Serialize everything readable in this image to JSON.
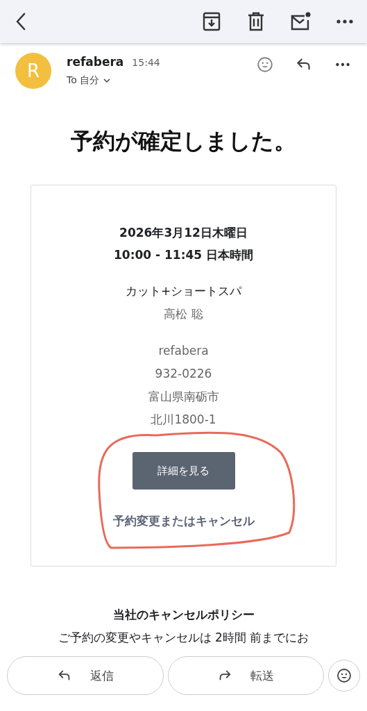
{
  "sender": {
    "avatar_letter": "R",
    "name": "refabera",
    "time": "15:44",
    "recipient": "To 自分"
  },
  "title": "予約が確定しました。",
  "card": {
    "date": "2026年3月12日木曜日",
    "time": "10:00 - 11:45 日本時間",
    "service": "カット+ショートスパ",
    "staff": "高松 聡",
    "address_lines": [
      "refabera",
      "932-0226",
      "富山県南砺市",
      "北川1800-1"
    ],
    "button": "詳細を見る",
    "link": "予約変更またはキャンセル"
  },
  "policy": {
    "title": "当社のキャンセルポリシー",
    "text": "ご予約の変更やキャンセルは 2時間 前までにお"
  },
  "actions": [
    {
      "kind": "reply",
      "label": "返信"
    },
    {
      "kind": "forward",
      "label": "転送"
    }
  ]
}
